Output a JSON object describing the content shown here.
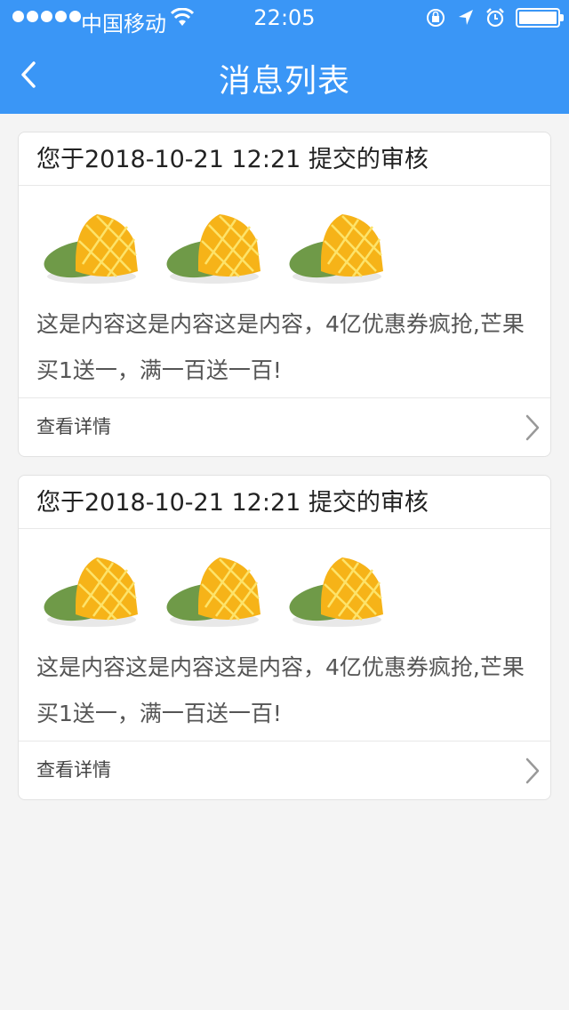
{
  "status_bar": {
    "carrier": "中国移动",
    "time": "22:05",
    "icons": [
      "signal-icon",
      "wifi-icon",
      "orientation-lock-icon",
      "location-icon",
      "alarm-icon",
      "battery-icon"
    ]
  },
  "nav": {
    "title": "消息列表",
    "back_icon": "chevron-left-icon"
  },
  "colors": {
    "header_bg": "#3a96f6",
    "page_bg": "#f4f4f4",
    "card_bg": "#ffffff"
  },
  "messages": [
    {
      "title": "您于2018-10-21 12:21 提交的审核",
      "images": [
        "mango-image",
        "mango-image",
        "mango-image"
      ],
      "content": "这是内容这是内容这是内容，4亿优惠券疯抢,芒果买1送一，满一百送一百!",
      "footer_label": "查看详情"
    },
    {
      "title": "您于2018-10-21 12:21 提交的审核",
      "images": [
        "mango-image",
        "mango-image",
        "mango-image"
      ],
      "content": "这是内容这是内容这是内容，4亿优惠券疯抢,芒果买1送一，满一百送一百!",
      "footer_label": "查看详情"
    }
  ]
}
